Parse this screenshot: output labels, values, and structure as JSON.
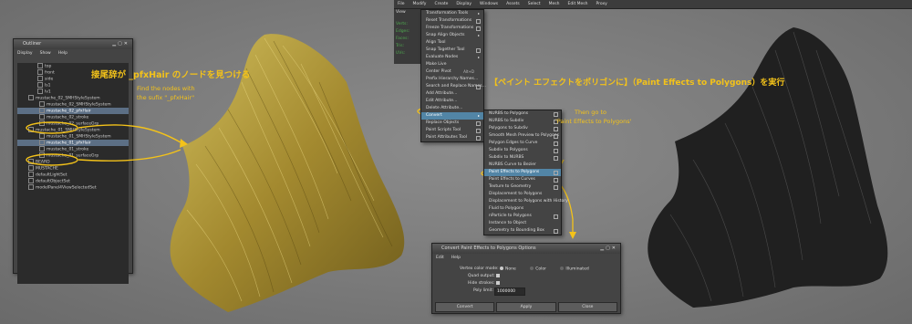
{
  "outliner": {
    "title": "Outliner",
    "menu": [
      "Display",
      "Show",
      "Help"
    ],
    "rows": [
      {
        "label": "top",
        "selected": false
      },
      {
        "label": "front",
        "selected": false
      },
      {
        "label": "side",
        "selected": false
      },
      {
        "label": "ls1",
        "selected": false
      },
      {
        "label": "lv1",
        "selected": false
      },
      {
        "label": "mustache_02_SMHStyleSystem",
        "selected": false
      },
      {
        "label": "mustache_02_SMHStyleSystem",
        "selected": false
      },
      {
        "label": "mustache_02_pfxHair",
        "selected": true
      },
      {
        "label": "mustache_02_stroke",
        "selected": false
      },
      {
        "label": "mustache_02_surfaceGrp",
        "selected": false
      },
      {
        "label": "mustache_01_SMHStyleSystem",
        "selected": false
      },
      {
        "label": "mustache_01_SMHStyleSystem",
        "selected": false
      },
      {
        "label": "mustache_01_pfxHair",
        "selected": true
      },
      {
        "label": "mustache_01_stroke",
        "selected": false
      },
      {
        "label": "mustache_01_surfaceGrp",
        "selected": false
      },
      {
        "label": "BEARD",
        "selected": false
      },
      {
        "label": "MUSTACHE",
        "selected": false
      },
      {
        "label": "defaultLightSet",
        "selected": false
      },
      {
        "label": "defaultObjectSet",
        "selected": false
      },
      {
        "label": "modelPanel4ViewSelectedSet",
        "selected": false
      }
    ]
  },
  "annotations": {
    "find_jp": "接尾辞が _pfxHair のノードを見つける",
    "find_en_1": "Find the nodes with",
    "find_en_2": "the sufix \"_pfxHair\"",
    "convert_jp": "【ペイント エフェクトをポリゴンに】（Paint Effects to Polygons）を実行",
    "then_1": "Then go to",
    "then_2": "'Paint Effects to Polygons'"
  },
  "maya_menubar": [
    "File",
    "Modify",
    "Create",
    "Display",
    "Windows",
    "Assets",
    "Select",
    "Mesh",
    "Edit Mesh",
    "Proxy"
  ],
  "modify_menu": [
    {
      "label": "Transformation Tools",
      "sub": true
    },
    {
      "label": "Reset Transformations",
      "opt": true
    },
    {
      "label": "Freeze Transformations",
      "opt": true
    },
    {
      "label": "Snap Align Objects",
      "sub": true
    },
    {
      "label": "Align Tool"
    },
    {
      "label": "Snap Together Tool",
      "opt": true
    },
    {
      "label": "Evaluate Nodes",
      "sub": true
    },
    {
      "label": "Make Live"
    },
    {
      "label": "Center Pivot",
      "shortcut": "Alt+D"
    },
    {
      "label": "Prefix Hierarchy Names..."
    },
    {
      "label": "Search and Replace Names...",
      "opt": true
    },
    {
      "label": "Add Attribute..."
    },
    {
      "label": "Edit Attribute..."
    },
    {
      "label": "Delete Attribute..."
    },
    {
      "label": "Convert",
      "sub": true,
      "hl": true
    },
    {
      "label": "Replace Objects",
      "opt": true
    },
    {
      "label": "Paint Scripts Tool",
      "opt": true
    },
    {
      "label": "Paint Attributes Tool",
      "opt": true
    }
  ],
  "convert_menu": [
    {
      "label": "NURBS to Polygons",
      "opt": true
    },
    {
      "label": "NURBS to Subdiv",
      "opt": true
    },
    {
      "label": "Polygons to Subdiv",
      "opt": true
    },
    {
      "label": "Smooth Mesh Preview to Polygons",
      "opt": true
    },
    {
      "label": "Polygon Edges to Curve",
      "opt": true
    },
    {
      "label": "Subdiv to Polygons",
      "opt": true
    },
    {
      "label": "Subdiv to NURBS",
      "opt": true
    },
    {
      "label": "NURBS Curve to Bezier"
    },
    {
      "label": "Paint Effects to Polygons",
      "opt": true,
      "hl": true
    },
    {
      "label": "Paint Effects to Curves",
      "opt": true
    },
    {
      "label": "Texture to Geometry",
      "opt": true
    },
    {
      "label": "Displacement to Polygons"
    },
    {
      "label": "Displacement to Polygons with History"
    },
    {
      "label": "Fluid to Polygons"
    },
    {
      "label": "nParticle to Polygons",
      "opt": true
    },
    {
      "label": "Instance to Object"
    },
    {
      "label": "Geometry to Bounding Box",
      "opt": true
    }
  ],
  "options_window": {
    "title": "Convert Paint Effects to Polygons Options",
    "menu": [
      "Edit",
      "Help"
    ],
    "vertex_color_label": "Vertex color mode:",
    "vertex_color_options": [
      "None",
      "Color",
      "Illuminated"
    ],
    "quad_label": "Quad output:",
    "hide_label": "Hide strokes:",
    "poly_limit_label": "Poly limit:",
    "poly_limit_value": "1000000",
    "buttons": [
      "Convert",
      "Apply",
      "Close"
    ]
  },
  "left_panel_labels": [
    "Verts:",
    "Edges:",
    "Faces:",
    "Tris:",
    "UVs:"
  ],
  "view_label": "View"
}
